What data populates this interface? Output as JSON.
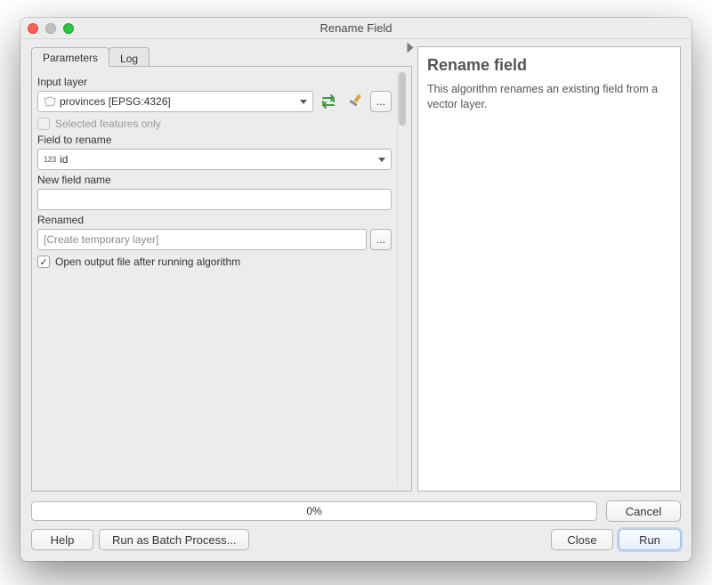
{
  "window": {
    "title": "Rename Field"
  },
  "tabs": {
    "parameters": "Parameters",
    "log": "Log"
  },
  "params": {
    "input_layer_label": "Input layer",
    "input_layer_value": "provinces [EPSG:4326]",
    "selected_only": "Selected features only",
    "field_label": "Field to rename",
    "field_badge": "123",
    "field_value": "id",
    "new_name_label": "New field name",
    "new_name_value": "",
    "renamed_label": "Renamed",
    "renamed_placeholder": "[Create temporary layer]",
    "open_after": "Open output file after running algorithm",
    "open_after_checked": true
  },
  "info": {
    "heading": "Rename field",
    "body": "This algorithm renames an existing field from a vector layer."
  },
  "progress": {
    "text": "0%"
  },
  "buttons": {
    "cancel": "Cancel",
    "help": "Help",
    "batch": "Run as Batch Process...",
    "close": "Close",
    "run": "Run",
    "dots": "..."
  }
}
